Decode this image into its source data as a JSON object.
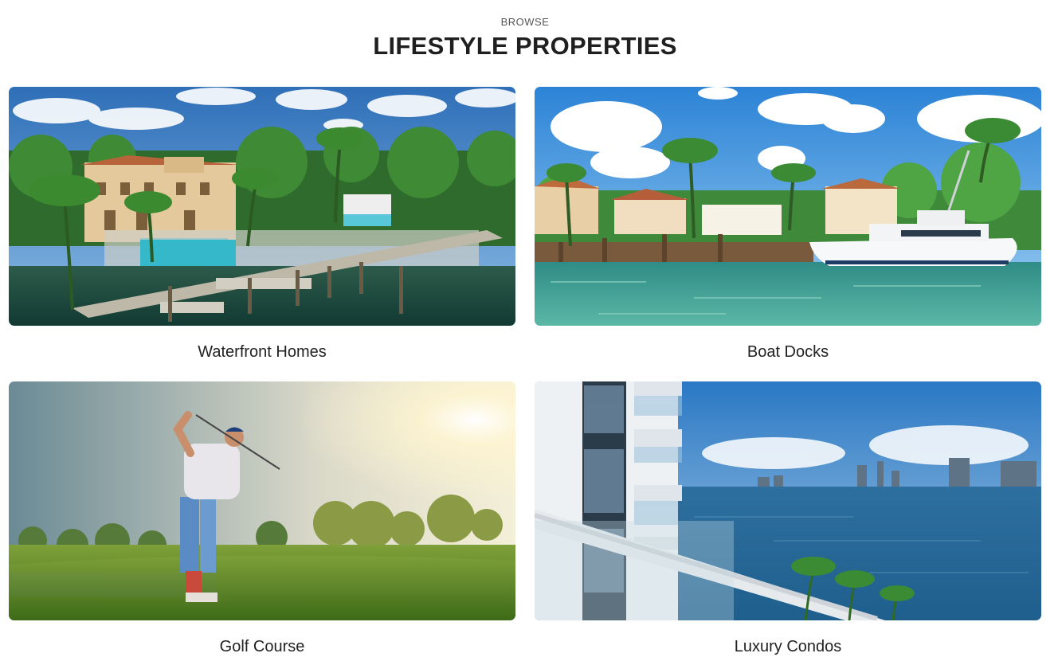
{
  "header": {
    "eyebrow": "BROWSE",
    "title": "LIFESTYLE PROPERTIES"
  },
  "cards": [
    {
      "label": "Waterfront Homes",
      "photo": "waterfront-mansion-pool-dock-photo"
    },
    {
      "label": "Boat Docks",
      "photo": "yacht-at-waterfront-dock-photo"
    },
    {
      "label": "Golf Course",
      "photo": "golfer-swinging-on-course-photo"
    },
    {
      "label": "Luxury Condos",
      "photo": "condo-balcony-bay-view-photo"
    }
  ]
}
